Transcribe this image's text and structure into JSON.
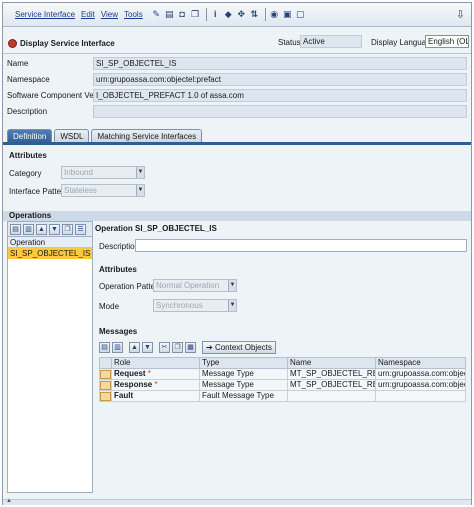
{
  "menu": {
    "items": [
      "Service Interface",
      "Edit",
      "View",
      "Tools"
    ],
    "toolbar_icons": [
      "edit-toggle-icon",
      "save-icon",
      "activate-icon",
      "copy-icon",
      "info-icon",
      "back-icon",
      "navigate-icon",
      "where-used-icon",
      "history-icon",
      "print-icon",
      "window-icon"
    ]
  },
  "title": {
    "text": "Display Service Interface",
    "status_label": "Status",
    "status_value": "Active",
    "language_label": "Display Language",
    "language_value": "English (OL)"
  },
  "header": {
    "name_label": "Name",
    "name_value": "SI_SP_OBJECTEL_IS",
    "namespace_label": "Namespace",
    "namespace_value": "urn:grupoassa.com:objectel:prefact",
    "swcv_label": "Software Component Version",
    "swcv_value": "I_OBJECTEL_PREFACT 1.0 of assa.com",
    "description_label": "Description",
    "description_value": ""
  },
  "tabs": [
    "Definition",
    "WSDL",
    "Matching Service Interfaces"
  ],
  "attributes": {
    "title": "Attributes",
    "category_label": "Category",
    "category_value": "Inbound",
    "pattern_label": "Interface Pattern",
    "pattern_value": "Stateless"
  },
  "operations": {
    "title": "Operations",
    "column_header": "Operation",
    "items": [
      "SI_SP_OBJECTEL_IS"
    ]
  },
  "operation_detail": {
    "title": "Operation SI_SP_OBJECTEL_IS",
    "description_label": "Description",
    "attributes_title": "Attributes",
    "op_pattern_label": "Operation Pattern",
    "op_pattern_value": "Normal Operation",
    "mode_label": "Mode",
    "mode_value": "Synchronous"
  },
  "messages": {
    "title": "Messages",
    "context_button": "Context Objects",
    "columns": [
      "Role",
      "Type",
      "Name",
      "Namespace"
    ],
    "rows": [
      {
        "role": "Request",
        "required": "*",
        "type": "Message Type",
        "name": "MT_SP_OBJECTEL_REQUEST",
        "namespace": "urn:grupoassa.com:objectel:pref"
      },
      {
        "role": "Response",
        "required": "*",
        "type": "Message Type",
        "name": "MT_SP_OBJECTEL_RESPONSE",
        "namespace": "urn:grupoassa.com:objectel:pref"
      },
      {
        "role": "Fault",
        "required": "",
        "type": "Fault Message Type",
        "name": "",
        "namespace": ""
      }
    ]
  }
}
